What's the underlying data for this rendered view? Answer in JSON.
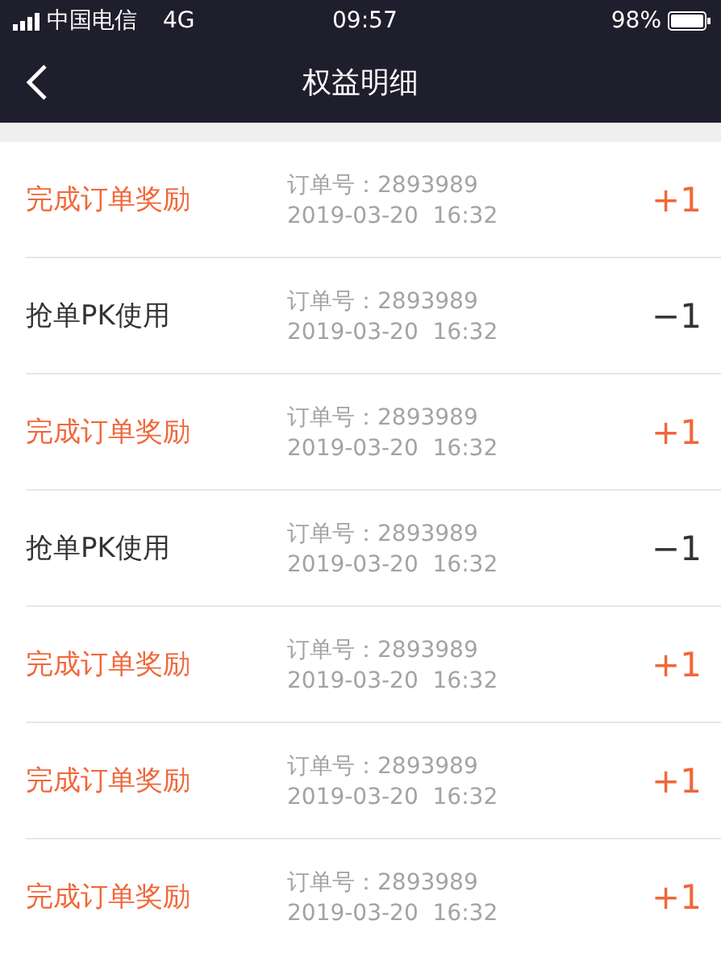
{
  "status_bar": {
    "carrier": "中国电信",
    "network": "4G",
    "time": "09:57",
    "battery": "98%"
  },
  "nav": {
    "title": "权益明细"
  },
  "records": [
    {
      "kind": "gain",
      "label": "完成订单奖励",
      "order": "订单号：2893989",
      "datetime": "2019-03-20  16:32",
      "amount": "+1"
    },
    {
      "kind": "spend",
      "label": "抢单PK使用",
      "order": "订单号：2893989",
      "datetime": "2019-03-20  16:32",
      "amount": "−1"
    },
    {
      "kind": "gain",
      "label": "完成订单奖励",
      "order": "订单号：2893989",
      "datetime": "2019-03-20  16:32",
      "amount": "+1"
    },
    {
      "kind": "spend",
      "label": "抢单PK使用",
      "order": "订单号：2893989",
      "datetime": "2019-03-20  16:32",
      "amount": "−1"
    },
    {
      "kind": "gain",
      "label": "完成订单奖励",
      "order": "订单号：2893989",
      "datetime": "2019-03-20  16:32",
      "amount": "+1"
    },
    {
      "kind": "gain",
      "label": "完成订单奖励",
      "order": "订单号：2893989",
      "datetime": "2019-03-20  16:32",
      "amount": "+1"
    },
    {
      "kind": "gain",
      "label": "完成订单奖励",
      "order": "订单号：2893989",
      "datetime": "2019-03-20  16:32",
      "amount": "+1"
    }
  ]
}
